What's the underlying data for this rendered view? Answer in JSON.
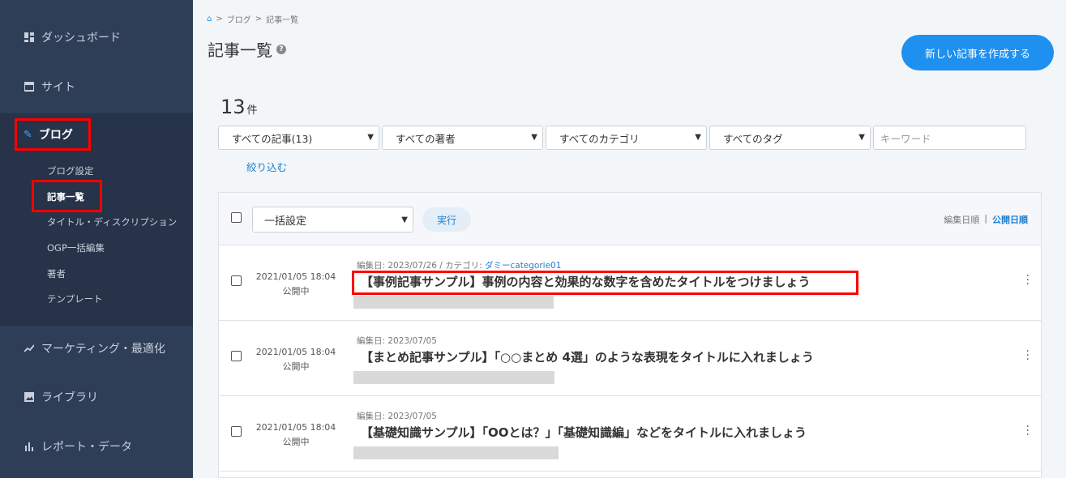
{
  "sidebar": {
    "items": [
      {
        "label": "ダッシュボード",
        "icon": "dashboard-icon"
      },
      {
        "label": "サイト",
        "icon": "site-icon"
      },
      {
        "label": "ブログ",
        "icon": "pencil-icon"
      },
      {
        "label": "マーケティング・最適化",
        "icon": "trend-icon"
      },
      {
        "label": "ライブラリ",
        "icon": "image-icon"
      },
      {
        "label": "レポート・データ",
        "icon": "bar-chart-icon"
      }
    ],
    "blog_sub": [
      "ブログ設定",
      "記事一覧",
      "タイトル・ディスクリプション",
      "OGP一括編集",
      "著者",
      "テンプレート"
    ]
  },
  "breadcrumb": {
    "sep": ">",
    "blog": "ブログ",
    "current": "記事一覧"
  },
  "header": {
    "title": "記事一覧",
    "help": "?",
    "new_button": "新しい記事を作成する"
  },
  "count": {
    "value": "13",
    "unit": "件"
  },
  "filters": {
    "articles": "すべての記事(13)",
    "authors": "すべての著者",
    "categories": "すべてのカテゴリ",
    "tags": "すべてのタグ",
    "keyword_placeholder": "キーワード",
    "apply": "絞り込む"
  },
  "table": {
    "bulk": "一括設定",
    "exec": "実行",
    "sort_edit": "編集日順",
    "sort_sep": "|",
    "sort_publish": "公開日順",
    "rows": [
      {
        "date": "2021/01/05 18:04",
        "status": "公開中",
        "meta": "編集日: 2023/07/26 / カテゴリ: ",
        "category": "ダミーcategorie01",
        "title": "【事例記事サンプル】事例の内容と効果的な数字を含めたタイトルをつけましょう"
      },
      {
        "date": "2021/01/05 18:04",
        "status": "公開中",
        "meta": "編集日: 2023/07/05",
        "category": "",
        "title": "【まとめ記事サンプル】「○○まとめ 4選」のような表現をタイトルに入れましょう"
      },
      {
        "date": "2021/01/05 18:04",
        "status": "公開中",
        "meta": "編集日: 2023/07/05",
        "category": "",
        "title": "【基礎知識サンプル】「OOとは？」「基礎知識編」などをタイトルに入れましょう"
      }
    ]
  },
  "colors": {
    "sidebar": "#2f3e57",
    "accent": "#1e90f0",
    "highlight": "#ff0000"
  }
}
